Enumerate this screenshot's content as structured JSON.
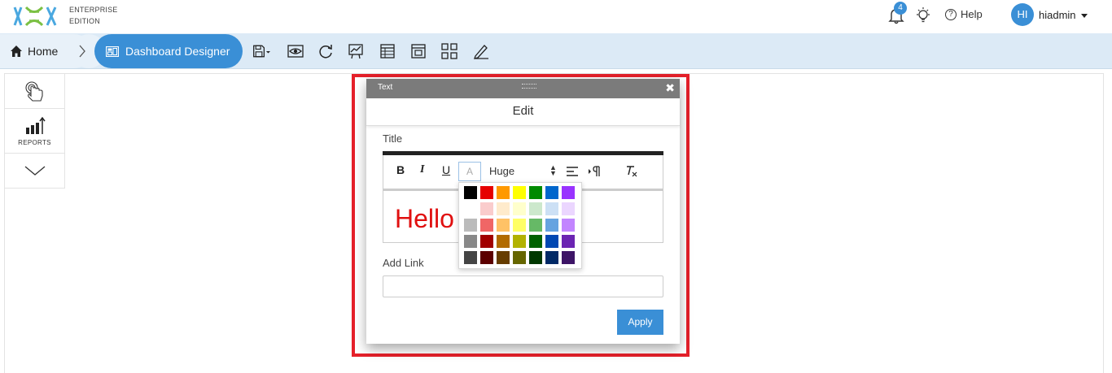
{
  "header": {
    "edition_line1": "ENTERPRISE",
    "edition_line2": "EDITION",
    "notification_count": "4",
    "help_label": "Help",
    "help_glyph": "?",
    "avatar_initials": "HI",
    "username": "hiadmin"
  },
  "toolbar": {
    "home_label": "Home",
    "active_label": "Dashboard Designer",
    "icons": [
      "save-icon",
      "preview-eye-icon",
      "refresh-icon",
      "chart-icon",
      "table-icon",
      "layout-icon",
      "grid-icon",
      "edit-icon"
    ]
  },
  "left_panel": {
    "reports_label": "REPORTS"
  },
  "modal": {
    "title": "Text",
    "close_glyph": "✖",
    "tab_label": "Edit",
    "title_field_label": "Title",
    "editor": {
      "bold": "B",
      "italic": "I",
      "underline": "U",
      "color_glyph": "A",
      "size": "Huge",
      "clear_format": "Tx",
      "content": "Hello"
    },
    "link_label": "Add Link",
    "link_value": "",
    "apply_label": "Apply"
  },
  "palette": [
    [
      "#000000",
      "#e60000",
      "#ff9900",
      "#ffff00",
      "#008a00",
      "#0066cc",
      "#9933ff"
    ],
    [
      "#ffffff",
      "#facccc",
      "#ffebcc",
      "#ffffcc",
      "#cce8cc",
      "#cce0f5",
      "#ebd6ff"
    ],
    [
      "#bbbbbb",
      "#f06666",
      "#ffc266",
      "#ffff66",
      "#66b966",
      "#66a3e0",
      "#c285ff"
    ],
    [
      "#888888",
      "#a10000",
      "#b26b00",
      "#b2b200",
      "#006100",
      "#0047b2",
      "#6b24b2"
    ],
    [
      "#444444",
      "#5c0000",
      "#663d00",
      "#666600",
      "#003700",
      "#002966",
      "#3d1466"
    ]
  ],
  "colors": {
    "accent": "#3a8fd6",
    "highlight": "#e5202a",
    "toolbar_bg": "#dceaf6",
    "text_red": "#e01010"
  }
}
